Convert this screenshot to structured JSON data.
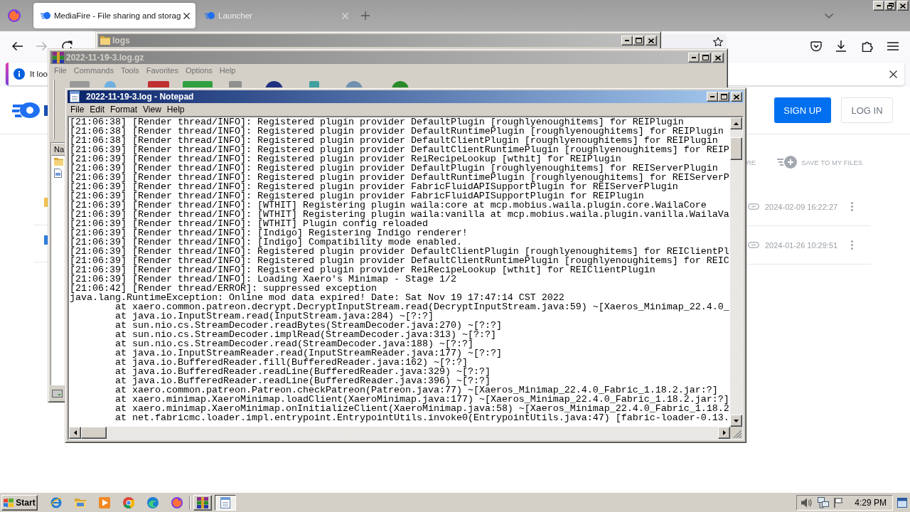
{
  "browser": {
    "tabs": [
      {
        "title": "MediaFire - File sharing and storag",
        "selected": true
      },
      {
        "title": "Launcher",
        "selected": false
      }
    ],
    "notification": {
      "text": "It loo"
    },
    "page": {
      "buttons": [
        {
          "label": "SIGN UP",
          "kind": "primary"
        },
        {
          "label": "LOG IN",
          "kind": "secondary"
        }
      ],
      "actions": [
        {
          "label": "RE",
          "kind": "plain"
        },
        {
          "label": "SAVE TO MY FILES",
          "kind": "save"
        }
      ],
      "files": [
        {
          "date": "2024-02-09 16:22:27"
        },
        {
          "date": "2024-01-26 10:29:51"
        }
      ]
    }
  },
  "explorer_window": {
    "title": "logs",
    "active": false
  },
  "archive_window": {
    "title": "2022-11-19-3.log.gz",
    "active": false,
    "menu": [
      "File",
      "Commands",
      "Tools",
      "Favorites",
      "Options",
      "Help"
    ],
    "column_header": "Na"
  },
  "notepad_window": {
    "title": "2022-11-19-3.log - Notepad",
    "active": true,
    "menu": [
      "File",
      "Edit",
      "Format",
      "View",
      "Help"
    ],
    "lines": [
      {
        "kind": "log",
        "text": "[21:06:38] [Render thread/INFO]: Registered plugin provider DefaultPlugin [roughlyenoughitems] for REIPlugin"
      },
      {
        "kind": "log",
        "text": "[21:06:38] [Render thread/INFO]: Registered plugin provider DefaultRuntimePlugin [roughlyenoughitems] for REIPlugin"
      },
      {
        "kind": "log",
        "text": "[21:06:38] [Render thread/INFO]: Registered plugin provider DefaultClientPlugin [roughlyenoughitems] for REIPlugin"
      },
      {
        "kind": "log",
        "text": "[21:06:39] [Render thread/INFO]: Registered plugin provider DefaultClientRuntimePlugin [roughlyenoughitems] for REIP"
      },
      {
        "kind": "log",
        "text": "[21:06:39] [Render thread/INFO]: Registered plugin provider ReiRecipeLookup [wthit] for REIPlugin"
      },
      {
        "kind": "log",
        "text": "[21:06:39] [Render thread/INFO]: Registered plugin provider DefaultPlugin [roughlyenoughitems] for REIServerPlugin"
      },
      {
        "kind": "log",
        "text": "[21:06:39] [Render thread/INFO]: Registered plugin provider DefaultRuntimePlugin [roughlyenoughitems] for REIServerP"
      },
      {
        "kind": "log",
        "text": "[21:06:39] [Render thread/INFO]: Registered plugin provider FabricFluidAPISupportPlugin for REIServerPlugin"
      },
      {
        "kind": "log",
        "text": "[21:06:39] [Render thread/INFO]: Registered plugin provider FabricFluidAPISupportPlugin for REIPlugin"
      },
      {
        "kind": "log",
        "text": "[21:06:39] [Render thread/INFO]: [WTHIT] Registering plugin waila:core at mcp.mobius.waila.plugin.core.WailaCore"
      },
      {
        "kind": "log",
        "text": "[21:06:39] [Render thread/INFO]: [WTHIT] Registering plugin waila:vanilla at mcp.mobius.waila.plugin.vanilla.WailaVa"
      },
      {
        "kind": "log",
        "text": "[21:06:39] [Render thread/INFO]: [WTHIT] Plugin config reloaded"
      },
      {
        "kind": "log",
        "text": "[21:06:39] [Render thread/INFO]: [Indigo] Registering Indigo renderer!"
      },
      {
        "kind": "log",
        "text": "[21:06:39] [Render thread/INFO]: [Indigo] Compatibility mode enabled."
      },
      {
        "kind": "log",
        "text": "[21:06:39] [Render thread/INFO]: Registered plugin provider DefaultClientPlugin [roughlyenoughitems] for REIClientPl"
      },
      {
        "kind": "log",
        "text": "[21:06:39] [Render thread/INFO]: Registered plugin provider DefaultClientRuntimePlugin [roughlyenoughitems] for REIC"
      },
      {
        "kind": "log",
        "text": "[21:06:39] [Render thread/INFO]: Registered plugin provider ReiRecipeLookup [wthit] for REIClientPlugin"
      },
      {
        "kind": "log",
        "text": "[21:06:39] [Render thread/INFO]: Loading Xaero's Minimap - Stage 1/2"
      },
      {
        "kind": "log",
        "text": "[21:06:42] [Render thread/ERROR]: suppressed exception"
      },
      {
        "kind": "log",
        "text": "java.lang.RuntimeException: Online mod data expired! Date: Sat Nov 19 17:47:14 CST 2022"
      },
      {
        "kind": "trace",
        "text": "at xaero.common.patreon.decrypt.DecryptInputStream.read(DecryptInputStream.java:59) ~[Xaeros_Minimap_22.4.0_"
      },
      {
        "kind": "trace",
        "text": "at java.io.InputStream.read(InputStream.java:284) ~[?:?]"
      },
      {
        "kind": "trace",
        "text": "at sun.nio.cs.StreamDecoder.readBytes(StreamDecoder.java:270) ~[?:?]"
      },
      {
        "kind": "trace",
        "text": "at sun.nio.cs.StreamDecoder.implRead(StreamDecoder.java:313) ~[?:?]"
      },
      {
        "kind": "trace",
        "text": "at sun.nio.cs.StreamDecoder.read(StreamDecoder.java:188) ~[?:?]"
      },
      {
        "kind": "trace",
        "text": "at java.io.InputStreamReader.read(InputStreamReader.java:177) ~[?:?]"
      },
      {
        "kind": "trace",
        "text": "at java.io.BufferedReader.fill(BufferedReader.java:162) ~[?:?]"
      },
      {
        "kind": "trace",
        "text": "at java.io.BufferedReader.readLine(BufferedReader.java:329) ~[?:?]"
      },
      {
        "kind": "trace",
        "text": "at java.io.BufferedReader.readLine(BufferedReader.java:396) ~[?:?]"
      },
      {
        "kind": "trace",
        "text": "at xaero.common.patreon.Patreon.checkPatreon(Patreon.java:77) ~[Xaeros_Minimap_22.4.0_Fabric_1.18.2.jar:?]"
      },
      {
        "kind": "trace",
        "text": "at xaero.minimap.XaeroMinimap.loadClient(XaeroMinimap.java:177) ~[Xaeros_Minimap_22.4.0_Fabric_1.18.2.jar:?]"
      },
      {
        "kind": "trace",
        "text": "at xaero.minimap.XaeroMinimap.onInitializeClient(XaeroMinimap.java:58) ~[Xaeros_Minimap_22.4.0_Fabric_1.18.2"
      },
      {
        "kind": "trace",
        "text": "at net.fabricmc.loader.impl.entrypoint.EntrypointUtils.invoke0(EntrypointUtils.java:47) [fabric-loader-0.13."
      }
    ]
  },
  "taskbar": {
    "start": "Start",
    "tasks": [
      {
        "kind": "archive",
        "selected": false
      },
      {
        "kind": "notepad",
        "selected": true
      }
    ],
    "clock": "4:29 PM"
  }
}
